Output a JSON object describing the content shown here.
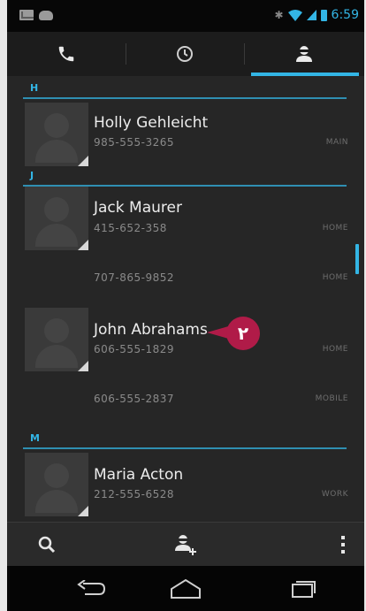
{
  "status_bar": {
    "time": "6:59",
    "icons": [
      "mail-icon",
      "cloud-icon",
      "bluetooth-icon",
      "wifi-icon",
      "signal-icon",
      "battery-icon"
    ]
  },
  "tabs": [
    {
      "name": "phone-tab",
      "icon": "phone-icon"
    },
    {
      "name": "recent-tab",
      "icon": "clock-icon"
    },
    {
      "name": "contacts-tab",
      "icon": "contact-icon",
      "selected": true
    }
  ],
  "sections": [
    {
      "letter": "H",
      "contacts": [
        {
          "name": "Holly Gehleicht",
          "numbers": [
            {
              "number": "985-555-3265",
              "type": "MAIN"
            }
          ]
        }
      ]
    },
    {
      "letter": "J",
      "contacts": [
        {
          "name": "Jack Maurer",
          "numbers": [
            {
              "number": "415-652-358",
              "type": "HOME"
            },
            {
              "number": "707-865-9852",
              "type": "HOME"
            }
          ]
        },
        {
          "name": "John Abrahams",
          "numbers": [
            {
              "number": "606-555-1829",
              "type": "HOME"
            },
            {
              "number": "606-555-2837",
              "type": "MOBILE"
            }
          ]
        }
      ]
    },
    {
      "letter": "M",
      "contacts": [
        {
          "name": "Maria Acton",
          "numbers": [
            {
              "number": "212-555-6528",
              "type": "WORK"
            }
          ]
        }
      ]
    }
  ],
  "callout": {
    "label": "٢"
  },
  "action_bar": {
    "buttons": [
      "search-icon",
      "add-contact-icon",
      "overflow-menu-icon"
    ]
  },
  "nav_bar": {
    "buttons": [
      "back-icon",
      "home-icon",
      "recent-apps-icon"
    ]
  },
  "colors": {
    "accent": "#33b5e5",
    "callout": "#b01b48",
    "background": "#262626"
  }
}
